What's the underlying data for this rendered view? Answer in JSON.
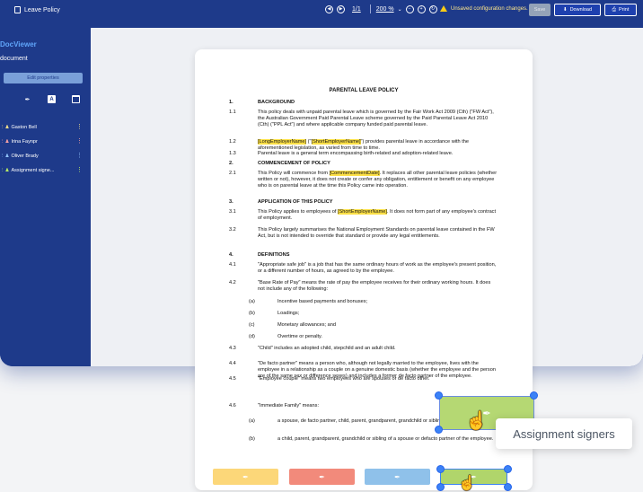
{
  "window": {
    "title": "Leave Policy"
  },
  "toolbar": {
    "page_info": "1/1",
    "zoom": "200 %",
    "warning": "Unsaved configuration changes.",
    "save_label": "Save",
    "download_label": "Download",
    "print_label": "Print"
  },
  "sidebar": {
    "brand": "DocViewer",
    "subtitle": "document",
    "edit_properties_label": "Edit properties",
    "signers": [
      {
        "label": "Gaston Bell"
      },
      {
        "label": "Irina Faynpr"
      },
      {
        "label": "Oliver Brady"
      },
      {
        "label": "Assignment signe..."
      }
    ]
  },
  "document": {
    "title": "PARENTAL LEAVE POLICY",
    "sections": [
      {
        "n": "1.",
        "text": "BACKGROUND",
        "heading": true
      },
      {
        "n": "1.1",
        "text": "This policy deals with unpaid parental leave which is governed by the Fair Work Act 2009 (Cth) (\"FW Act\"), the Australian Government Paid Parental Leave scheme governed by the Paid Parental Leave Act 2010 (Cth) (\"PPL Act\") and where applicable company funded paid parental leave."
      },
      {
        "n": "1.2",
        "text": "[LongEmployerName] (\"[ShortEmployerName]\") provides parental leave in accordance with the aforementioned legislation, as varied from time to time."
      },
      {
        "n": "1.3",
        "text": "Parental leave is a general term encompassing birth-related and adoption-related leave."
      },
      {
        "n": "2.",
        "text": "COMMENCEMENT OF POLICY",
        "heading": true
      },
      {
        "n": "2.1",
        "text": "This Policy will commence from [CommencementDate]. It replaces all other parental leave policies (whether written or not), however, it does not create or confer any obligation, entitlement or benefit on any employee who is on parental leave at the time this Policy came into operation."
      },
      {
        "n": "3.",
        "text": "APPLICATION OF THIS POLICY",
        "heading": true
      },
      {
        "n": "3.1",
        "text": "This Policy applies to employees of [ShortEmployerName]. It does not form part of any employee's contract of employment."
      },
      {
        "n": "3.2",
        "text": "This Policy largely summarises the National Employment Standards on parental leave contained in the FW Act, but is not intended to override that standard or provide any legal entitlements."
      },
      {
        "n": "4.",
        "text": "DEFINITIONS",
        "heading": true
      },
      {
        "n": "4.1",
        "text": "\"Appropriate safe job\" is a job that has the same ordinary hours of work as the employee's present position, or a different number of hours, as agreed to by the employee."
      },
      {
        "n": "4.2",
        "text": "\"Base Rate of Pay\" means the rate of pay the employee receives for their ordinary working hours. It does not include any of the following:"
      },
      {
        "n": "(a)",
        "text": "Incentive based payments and bonuses;",
        "sub": true
      },
      {
        "n": "(b)",
        "text": "Loadings;",
        "sub": true
      },
      {
        "n": "(c)",
        "text": "Monetary allowances; and",
        "sub": true
      },
      {
        "n": "(d)",
        "text": "Overtime or penalty.",
        "sub": true
      },
      {
        "n": "4.3",
        "text": "\"Child\" includes an adopted child, stepchild and an adult child."
      },
      {
        "n": "4.4",
        "text": "\"De facto partner\" means a person who, although not legally married to the employee, lives with the employee in a relationship as a couple on a genuine domestic basis (whether the employee and the person are of the same sex or difference sexes) and includes a former de facto partner of the employee."
      },
      {
        "n": "4.5",
        "text": "\"Employee couple\" means two employees who are spouses or de facto other."
      },
      {
        "n": "4.6",
        "text": "\"Immediate Family\" means:"
      },
      {
        "n": "(a)",
        "text": "a spouse, de facto partner, child, parent, grandparent, grandchild or sibling employee; or",
        "sub": true
      },
      {
        "n": "(b)",
        "text": "a child, parent, grandparent, grandchild or sibling of a spouse or defacto partner of the employee.",
        "sub": true
      }
    ]
  },
  "tooltip": "Assignment signers",
  "colors": {
    "frame": "#1e3a8a",
    "accent": "#3b82f6",
    "highlight": "#fde047",
    "yellow_field": "#fcd779",
    "red_field": "#f28a7b",
    "blue_field": "#8fc1ea",
    "green_field": "#b0d56b"
  }
}
